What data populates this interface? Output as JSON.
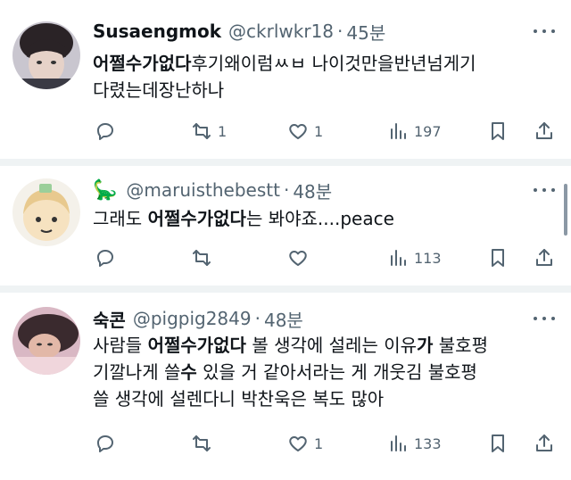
{
  "tweets": [
    {
      "name": "Susaengmok",
      "handle": "@ckrlwkr18",
      "time": "45분",
      "text_bold_1": "어쩔수가없다",
      "text_1": "후기왜이럼ㅆㅂ 나이것만을반년넘게기",
      "text_2": "다렸는데장난하나",
      "retweets": "1",
      "likes": "1",
      "views": "197"
    },
    {
      "emoji": "🦕",
      "handle": "@maruisthebestt",
      "time": "48분",
      "text_pre": "그래도 ",
      "text_bold_1": "어쩔수가없다",
      "text_post": "는 봐야죠....peace",
      "views": "113"
    },
    {
      "name": "숙콘",
      "handle": "@pigpig2849",
      "time": "48분",
      "l1_pre": "사람들 ",
      "l1_bold": "어쩔수가없다",
      "l1_mid": " 볼 생각에 설레는 이유",
      "l1_bold2": "가",
      "l1_post": " 불호평",
      "l2_pre": "기깔나게 쓸",
      "l2_bold": "수",
      "l2_post": " 있을 거 같아서라는 게 개웃김 불호평",
      "l3": "쓸 생각에 설렌다니 박찬욱은 복도 많아",
      "likes": "1",
      "views": "133"
    }
  ],
  "separator": "·",
  "icons": [
    "reply-icon",
    "retweet-icon",
    "like-icon",
    "views-icon",
    "bookmark-icon",
    "share-icon",
    "more-icon"
  ]
}
